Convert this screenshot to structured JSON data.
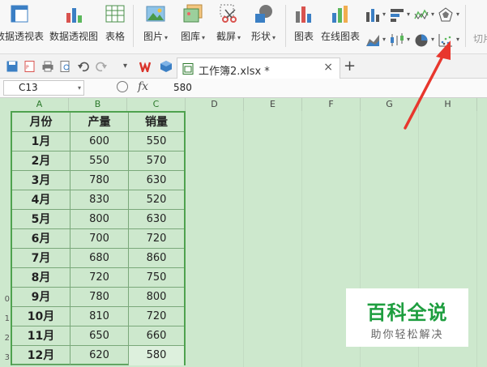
{
  "ribbon": {
    "pivot_table": "数据透视表",
    "pivot_chart": "数据透视图",
    "table": "表格",
    "picture": "图片",
    "gallery": "图库",
    "screenshot": "截屏",
    "shape": "形状",
    "chart": "图表",
    "online_chart": "在线图表",
    "cut": "切片"
  },
  "quick_access": {
    "doc_tab": "工作簿2.xlsx *",
    "tab_close": "×",
    "tab_add": "+"
  },
  "formula_bar": {
    "cell_ref": "C13",
    "fx": "fx",
    "value": "580"
  },
  "columns": [
    "A",
    "B",
    "C",
    "D",
    "E",
    "F",
    "G",
    "H"
  ],
  "row_numbers": [
    "0",
    "1",
    "2",
    "3"
  ],
  "table": {
    "headers": [
      "月份",
      "产量",
      "销量"
    ],
    "rows": [
      [
        "1月",
        "600",
        "550"
      ],
      [
        "2月",
        "550",
        "570"
      ],
      [
        "3月",
        "780",
        "630"
      ],
      [
        "4月",
        "830",
        "520"
      ],
      [
        "5月",
        "800",
        "630"
      ],
      [
        "6月",
        "700",
        "720"
      ],
      [
        "7月",
        "680",
        "860"
      ],
      [
        "8月",
        "720",
        "750"
      ],
      [
        "9月",
        "780",
        "800"
      ],
      [
        "10月",
        "810",
        "720"
      ],
      [
        "11月",
        "650",
        "660"
      ],
      [
        "12月",
        "620",
        "580"
      ]
    ]
  },
  "watermark": {
    "title": "百科全说",
    "subtitle": "助你轻松解决"
  },
  "colors": {
    "sheet_bg": "#cde8cd",
    "table_border": "#4fa24f",
    "annotation_arrow": "#e8362d",
    "watermark_text": "#1e9e3f"
  },
  "icons": {
    "pivot_table": "pivot-table-icon",
    "pivot_chart": "pivot-chart-icon",
    "table": "table-icon",
    "picture": "picture-icon",
    "gallery": "gallery-icon",
    "screenshot": "scissors-icon",
    "shape": "shape-icon",
    "chart": "bar-chart-icon",
    "online_chart": "online-chart-icon",
    "scatter": "scatter-chart-icon"
  }
}
